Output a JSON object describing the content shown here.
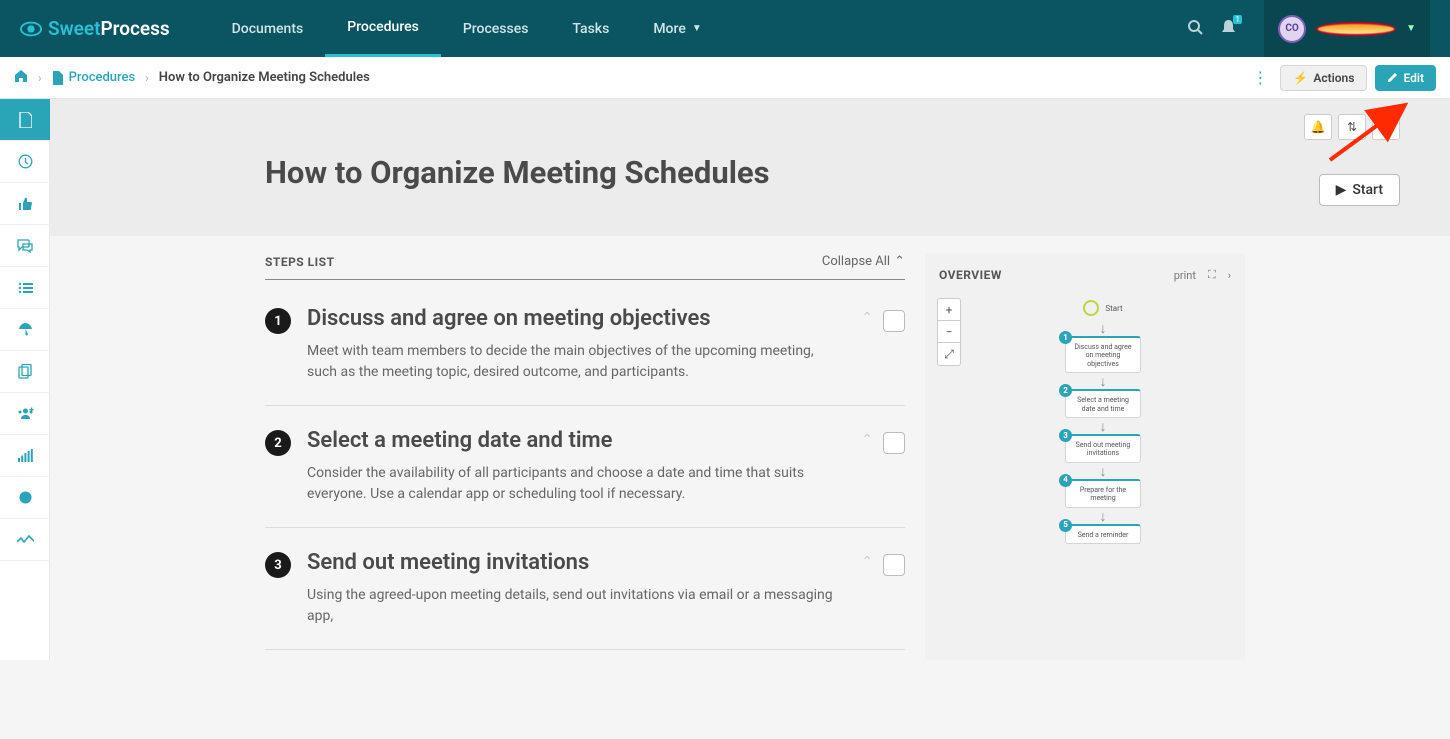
{
  "brand": {
    "sweet": "Sweet",
    "process": "Process"
  },
  "nav": {
    "documents": "Documents",
    "procedures": "Procedures",
    "processes": "Processes",
    "tasks": "Tasks",
    "more": "More"
  },
  "user": {
    "initials": "CO",
    "bell_count": "1"
  },
  "crumbs": {
    "procedures": "Procedures",
    "current": "How to Organize Meeting Schedules"
  },
  "actions": {
    "actions_label": "Actions",
    "edit_label": "Edit"
  },
  "hero": {
    "title": "How to Organize Meeting Schedules",
    "start": "Start"
  },
  "steps_header": {
    "title": "STEPS LIST",
    "collapse": "Collapse All"
  },
  "steps": [
    {
      "num": "1",
      "title": "Discuss and agree on meeting objectives",
      "desc": "Meet with team members to decide the main objectives of the upcoming meeting, such as the meeting topic, desired outcome, and participants."
    },
    {
      "num": "2",
      "title": "Select a meeting date and time",
      "desc": "Consider the availability of all participants and choose a date and time that suits everyone. Use a calendar app or scheduling tool if necessary."
    },
    {
      "num": "3",
      "title": "Send out meeting invitations",
      "desc": "Using the agreed-upon meeting details, send out invitations via email or a messaging app,"
    }
  ],
  "overview": {
    "title": "OVERVIEW",
    "print": "print",
    "start_label": "Start",
    "nodes": [
      {
        "num": "1",
        "label": "Discuss and agree on meeting objectives"
      },
      {
        "num": "2",
        "label": "Select a meeting date and time"
      },
      {
        "num": "3",
        "label": "Send out meeting invitations"
      },
      {
        "num": "4",
        "label": "Prepare for the meeting"
      },
      {
        "num": "5",
        "label": "Send a reminder"
      }
    ]
  }
}
